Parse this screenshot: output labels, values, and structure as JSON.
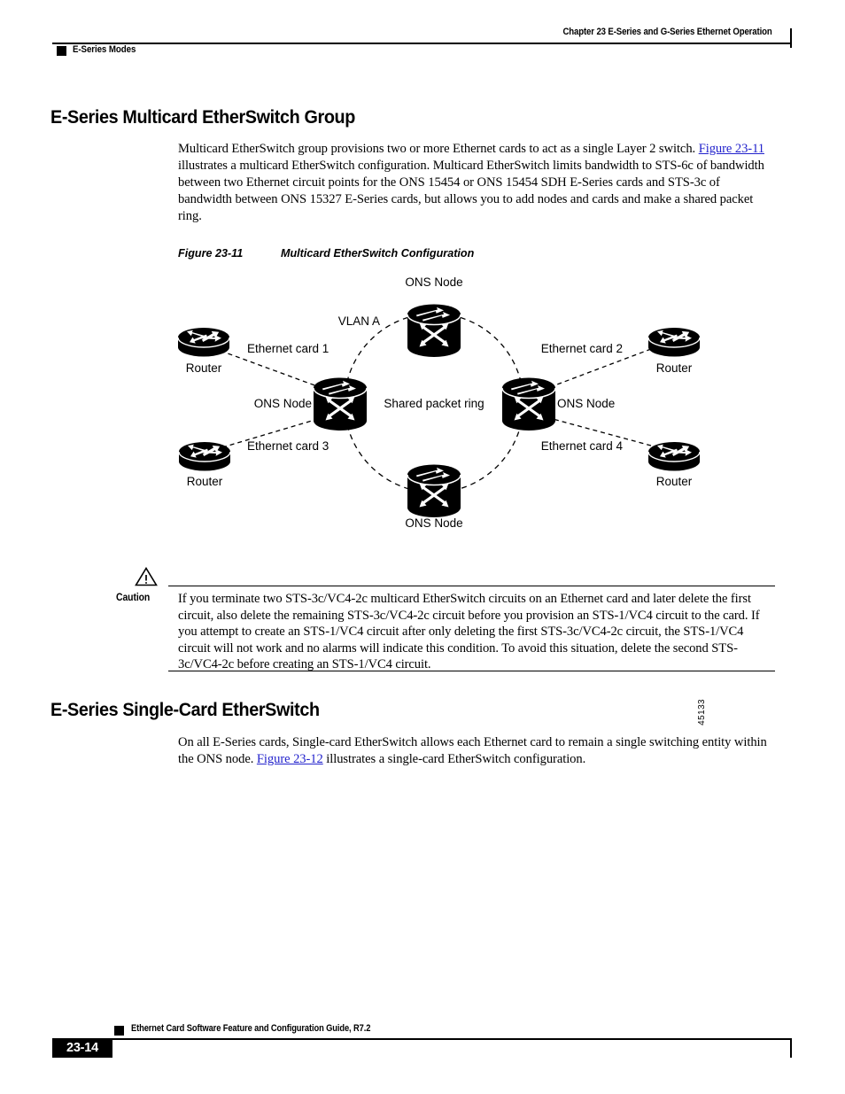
{
  "header": {
    "chapter": "Chapter 23 E-Series and G-Series Ethernet Operation",
    "section": "E-Series Modes"
  },
  "sections": {
    "multicard": {
      "heading": "E-Series Multicard EtherSwitch Group",
      "paragraph_part1": "Multicard EtherSwitch group provisions two or more Ethernet cards to act as a single Layer 2 switch. ",
      "paragraph_xref": "Figure 23-11",
      "paragraph_part2": " illustrates a multicard EtherSwitch configuration. Multicard EtherSwitch limits bandwidth to STS-6c of bandwidth between two Ethernet circuit points for the ONS 15454 or ONS 15454 SDH E-Series cards and STS-3c of bandwidth between ONS 15327 E-Series cards, but allows you to add nodes and cards and make a shared packet ring."
    },
    "singlecard": {
      "heading": "E-Series Single-Card EtherSwitch",
      "paragraph_part1": "On all E-Series cards, Single-card EtherSwitch allows each Ethernet card to remain a single switching entity within the ONS node. ",
      "paragraph_xref": "Figure 23-12",
      "paragraph_part2": " illustrates a single-card EtherSwitch configuration."
    }
  },
  "figure": {
    "number": "Figure 23-11",
    "title": "Multicard EtherSwitch Configuration",
    "art_id": "45133",
    "labels": {
      "ons_node_top": "ONS Node",
      "ons_node_left": "ONS Node",
      "ons_node_right": "ONS Node",
      "ons_node_bottom": "ONS Node",
      "vlan_a": "VLAN A",
      "shared_packet_ring": "Shared packet ring",
      "ethernet_card_1": "Ethernet card 1",
      "ethernet_card_2": "Ethernet card 2",
      "ethernet_card_3": "Ethernet card 3",
      "ethernet_card_4": "Ethernet card 4",
      "router_tl": "Router",
      "router_tr": "Router",
      "router_bl": "Router",
      "router_br": "Router"
    }
  },
  "caution": {
    "label": "Caution",
    "text": "If you terminate two STS-3c/VC4-2c multicard EtherSwitch circuits on an Ethernet card and later delete the first circuit, also delete the remaining STS-3c/VC4-2c circuit before you provision an STS-1/VC4 circuit to the card. If you attempt to create an STS-1/VC4 circuit after only deleting the first STS-3c/VC4-2c circuit, the STS-1/VC4 circuit will not work and no alarms will indicate this condition. To avoid this situation, delete the second STS-3c/VC4-2c before creating an STS-1/VC4 circuit."
  },
  "footer": {
    "guide_title": "Ethernet Card Software Feature and Configuration Guide, R7.2",
    "page_number": "23-14"
  },
  "colors": {
    "text": "#000000",
    "xref": "#2222cc",
    "background": "#ffffff"
  }
}
